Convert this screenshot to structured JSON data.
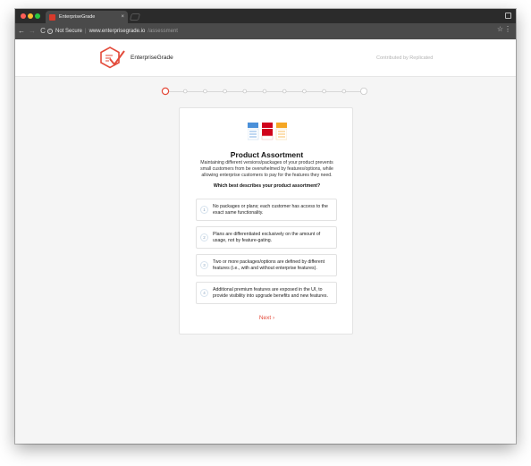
{
  "browser": {
    "tab_title": "EnterpriseGrade",
    "tab_close": "×",
    "security_label": "Not Secure",
    "url_host": "www.enterprisegrade.io",
    "url_path": "/assessment",
    "back_glyph": "←",
    "forward_glyph": "→",
    "reload_glyph": "C",
    "star_glyph": "☆",
    "menu_glyph": "⋮"
  },
  "header": {
    "brand_name": "EnterpriseGrade",
    "contributor_text": "Contributed by Replicated"
  },
  "stepper": {
    "total_steps": 11,
    "current_step": 1,
    "active_color": "#e34b3b",
    "inactive_color": "#c8c8c8"
  },
  "card": {
    "title": "Product Assortment",
    "description": "Maintaining different versions/packages of your product prevents small customers from be overwhelmed by features/options, while allowing enterprise customers to pay for the features they need.",
    "question": "Which best describes your product assortment?",
    "options": [
      {
        "number": "1",
        "text": "No packages or plans; each customer has access to the exact same functionality."
      },
      {
        "number": "2",
        "text": "Plans are differentiated exclusively on the amount of usage, not by feature-gating."
      },
      {
        "number": "3",
        "text": "Two or more packages/options are defined by different features (i.e., with and without enterprise features)."
      },
      {
        "number": "4",
        "text": "Additional premium features are exposed in the UI, to provide visibility into upgrade benefits and new features."
      }
    ],
    "next_label": "Next",
    "next_glyph": "›"
  },
  "colors": {
    "accent": "#e34b3b",
    "illustration_blue": "#4a90d9",
    "illustration_red": "#d0021b",
    "illustration_orange": "#f5a623"
  }
}
